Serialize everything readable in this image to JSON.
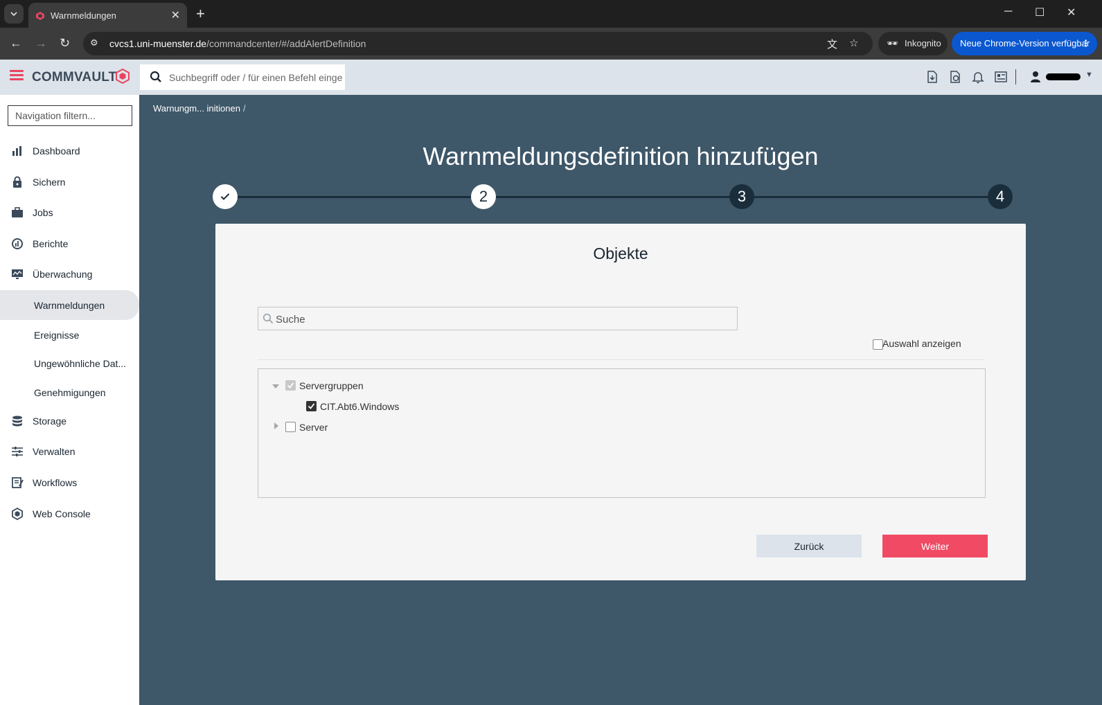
{
  "browser": {
    "tab_title": "Warnmeldungen",
    "url_host": "cvcs1.uni-muenster.de",
    "url_path": "/commandcenter/#/addAlertDefinition",
    "incognito_label": "Inkognito",
    "update_label": "Neue Chrome-Version verfügbar"
  },
  "header": {
    "brand": "COMMVAULT",
    "search_placeholder": "Suchbegriff oder / für einen Befehl eingeben"
  },
  "sidebar": {
    "filter_placeholder": "Navigation filtern...",
    "items": [
      {
        "label": "Dashboard",
        "icon": "dashboard-icon"
      },
      {
        "label": "Sichern",
        "icon": "lock-icon"
      },
      {
        "label": "Jobs",
        "icon": "briefcase-icon"
      },
      {
        "label": "Berichte",
        "icon": "reports-icon"
      },
      {
        "label": "Überwachung",
        "icon": "monitor-icon"
      },
      {
        "label": "Warnmeldungen",
        "sub": true,
        "active": true
      },
      {
        "label": "Ereignisse",
        "sub": true
      },
      {
        "label": "Ungewöhnliche Dat...",
        "sub": true
      },
      {
        "label": "Genehmigungen",
        "sub": true
      },
      {
        "label": "Storage",
        "icon": "database-icon"
      },
      {
        "label": "Verwalten",
        "icon": "sliders-icon"
      },
      {
        "label": "Workflows",
        "icon": "workflow-icon"
      },
      {
        "label": "Web Console",
        "icon": "web-console-icon"
      }
    ]
  },
  "main": {
    "breadcrumb": "Warnungm... initionen",
    "breadcrumb_sep": "/",
    "title": "Warnmeldungsdefinition hinzufügen",
    "steps": [
      "✓",
      "2",
      "3",
      "4"
    ],
    "card": {
      "title": "Objekte",
      "search_placeholder": "Suche",
      "show_selection_label": "Auswahl anzeigen",
      "tree": [
        {
          "label": "Servergruppen",
          "level": 0,
          "expanded": true,
          "checked": "partial"
        },
        {
          "label": "CIT.Abt6.Windows",
          "level": 1,
          "checked": true
        },
        {
          "label": "Server",
          "level": 0,
          "expanded": false,
          "checked": false
        }
      ],
      "back_label": "Zurück",
      "next_label": "Weiter"
    }
  },
  "colors": {
    "accent": "#f04a64",
    "main_bg": "#3e5769",
    "step_dark": "#1a2d3b"
  }
}
